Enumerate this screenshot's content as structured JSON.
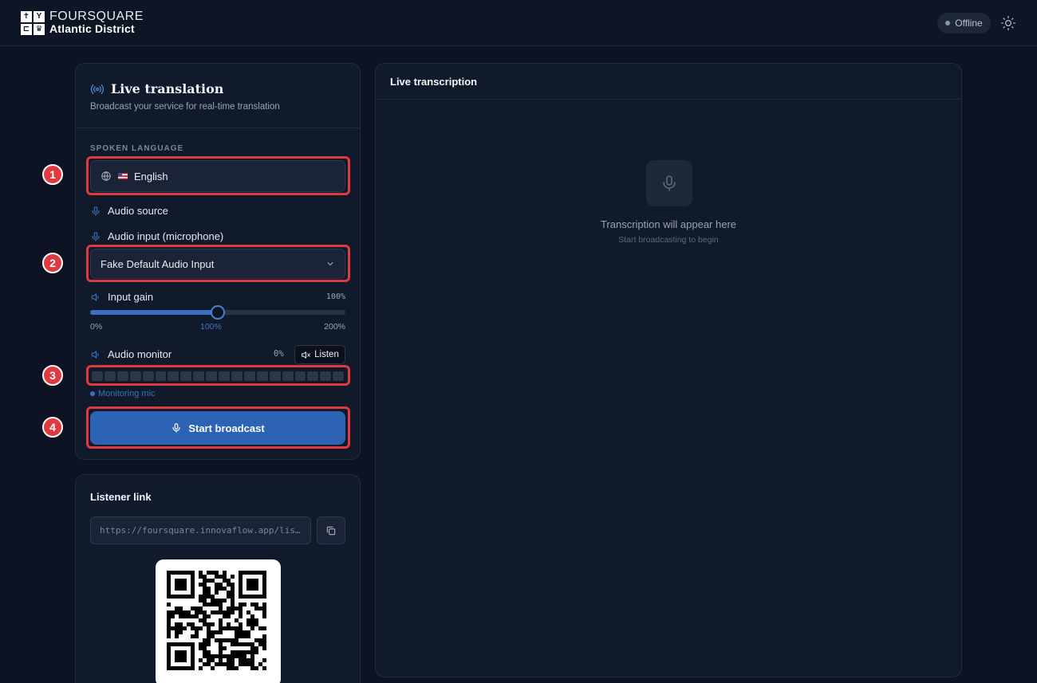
{
  "header": {
    "logo_line1": "FOURSQUARE",
    "logo_line2": "Atlantic District",
    "status": "Offline"
  },
  "broadcast": {
    "title": "Live translation",
    "subtitle": "Broadcast your service for real-time translation",
    "spoken_language_label": "SPOKEN LANGUAGE",
    "language_value": "English",
    "audio_source_label": "Audio source",
    "audio_input_label": "Audio input (microphone)",
    "audio_input_value": "Fake Default Audio Input",
    "input_gain_label": "Input gain",
    "input_gain_value": "100%",
    "input_gain_level": 0.5,
    "gain_ticks": [
      "0%",
      "100%",
      "200%"
    ],
    "audio_monitor_label": "Audio monitor",
    "monitor_percent": "0%",
    "listen_label": "Listen",
    "monitoring_status": "Monitoring mic",
    "start_button": "Start broadcast"
  },
  "annotations": [
    "1",
    "2",
    "3",
    "4"
  ],
  "listener": {
    "title": "Listener link",
    "url": "https://foursquare.innovaflow.app/lis…"
  },
  "transcription": {
    "title": "Live transcription",
    "placeholder": "Transcription will appear here",
    "hint": "Start broadcasting to begin"
  },
  "colors": {
    "accent": "#2d63b4",
    "highlight": "#e0393f",
    "background": "#0d1322"
  }
}
